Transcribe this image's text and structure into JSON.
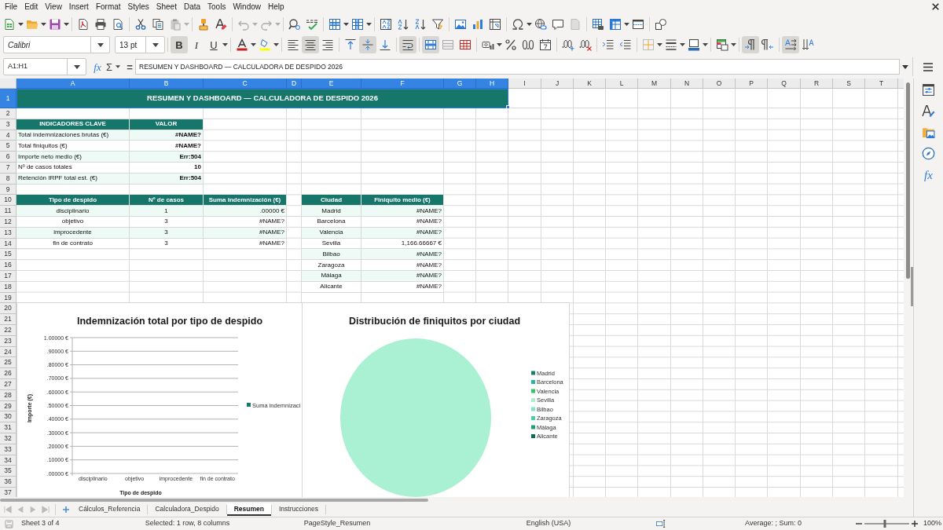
{
  "menu_bar": [
    "File",
    "Edit",
    "View",
    "Insert",
    "Format",
    "Styles",
    "Sheet",
    "Data",
    "Tools",
    "Window",
    "Help"
  ],
  "format_toolbar": {
    "font_name": "Calibri",
    "font_size": "13 pt",
    "bold": {
      "label": "B",
      "on": true
    },
    "italic": {
      "label": "I",
      "on": false
    },
    "underline": {
      "label": "U",
      "on": false
    },
    "align_left": false,
    "align_center": true,
    "align_right": false,
    "align_top": false,
    "align_middle": true,
    "align_bottom": false,
    "wrap_text": true,
    "merge_and_center": true,
    "merge_cells": false,
    "unmerge_cells": false,
    "left_to_right": true,
    "right_to_left": false,
    "text_horizontal": true,
    "text_vertical": false
  },
  "formula_bar": {
    "name_box": "A1:H1",
    "function_wizard": "fx",
    "sum": "Σ",
    "formula_sign": "=",
    "content": "RESUMEN Y DASHBOARD — CALCULADORA DE DESPIDO 2026"
  },
  "sidebar": {
    "functions": "fx"
  },
  "column_headers": [
    {
      "label": "A",
      "selected": true
    },
    {
      "label": "B",
      "selected": true
    },
    {
      "label": "C",
      "selected": true
    },
    {
      "label": "D",
      "selected": true
    },
    {
      "label": "E",
      "selected": true
    },
    {
      "label": "F",
      "selected": true
    },
    {
      "label": "G",
      "selected": true
    },
    {
      "label": "H",
      "selected": true
    },
    {
      "label": "I",
      "selected": false
    },
    {
      "label": "J",
      "selected": false
    },
    {
      "label": "K",
      "selected": false
    },
    {
      "label": "L",
      "selected": false
    },
    {
      "label": "M",
      "selected": false
    },
    {
      "label": "N",
      "selected": false
    },
    {
      "label": "O",
      "selected": false
    },
    {
      "label": "P",
      "selected": false
    },
    {
      "label": "Q",
      "selected": false
    },
    {
      "label": "R",
      "selected": false
    },
    {
      "label": "S",
      "selected": false
    },
    {
      "label": "T",
      "selected": false
    }
  ],
  "row_headers": [
    {
      "label": "1",
      "selected": true
    },
    {
      "label": "2",
      "selected": false
    },
    {
      "label": "3",
      "selected": false
    },
    {
      "label": "4",
      "selected": false
    },
    {
      "label": "5",
      "selected": false
    },
    {
      "label": "6",
      "selected": false
    },
    {
      "label": "7",
      "selected": false
    },
    {
      "label": "8",
      "selected": false
    },
    {
      "label": "9",
      "selected": false
    },
    {
      "label": "10",
      "selected": false
    },
    {
      "label": "11",
      "selected": false
    },
    {
      "label": "12",
      "selected": false
    },
    {
      "label": "13",
      "selected": false
    },
    {
      "label": "14",
      "selected": false
    },
    {
      "label": "15",
      "selected": false
    },
    {
      "label": "16",
      "selected": false
    },
    {
      "label": "17",
      "selected": false
    },
    {
      "label": "18",
      "selected": false
    },
    {
      "label": "19",
      "selected": false
    },
    {
      "label": "20",
      "selected": false
    },
    {
      "label": "21",
      "selected": false
    },
    {
      "label": "22",
      "selected": false
    },
    {
      "label": "23",
      "selected": false
    },
    {
      "label": "24",
      "selected": false
    },
    {
      "label": "25",
      "selected": false
    },
    {
      "label": "26",
      "selected": false
    },
    {
      "label": "27",
      "selected": false
    },
    {
      "label": "28",
      "selected": false
    },
    {
      "label": "29",
      "selected": false
    },
    {
      "label": "30",
      "selected": false
    },
    {
      "label": "31",
      "selected": false
    },
    {
      "label": "32",
      "selected": false
    },
    {
      "label": "33",
      "selected": false
    },
    {
      "label": "34",
      "selected": false
    },
    {
      "label": "35",
      "selected": false
    },
    {
      "label": "36",
      "selected": false
    },
    {
      "label": "37",
      "selected": false
    }
  ],
  "sheet": {
    "title": "RESUMEN Y DASHBOARD — CALCULADORA DE DESPIDO 2026",
    "kpi_table": {
      "columns": [
        "INDICADORES CLAVE",
        "VALOR"
      ],
      "rows": [
        {
          "label": "Total indemnizaciones brutas (€)",
          "value": "#NAME?"
        },
        {
          "label": "Total finiquitos (€)",
          "value": "#NAME?"
        },
        {
          "label": "Importe neto medio (€)",
          "value": "Err:504"
        },
        {
          "label": "Nº de casos totales",
          "value": "10"
        },
        {
          "label": "Retención IRPF total est. (€)",
          "value": "Err:504"
        }
      ]
    },
    "dismissal_table": {
      "columns": [
        "Tipo de despido",
        "Nº de casos",
        "Suma indemnización (€)"
      ],
      "rows": [
        [
          "disciplinario",
          "1",
          ".00000 €"
        ],
        [
          "objetivo",
          "3",
          "#NAME?"
        ],
        [
          "improcedente",
          "3",
          "#NAME?"
        ],
        [
          "fin de contrato",
          "3",
          "#NAME?"
        ]
      ]
    },
    "city_table": {
      "columns": [
        "Ciudad",
        "Finiquito medio (€)"
      ],
      "rows": [
        [
          "Madrid",
          "#NAME?"
        ],
        [
          "Barcelona",
          "#NAME?"
        ],
        [
          "Valencia",
          "#NAME?"
        ],
        [
          "Sevilla",
          "1,166.66667 €"
        ],
        [
          "Bilbao",
          "#NAME?"
        ],
        [
          "Zaragoza",
          "#NAME?"
        ],
        [
          "Málaga",
          "#NAME?"
        ],
        [
          "Alicante",
          "#NAME?"
        ]
      ]
    }
  },
  "charts": [
    {
      "chart_data": {
        "type": "bar",
        "title": "Indemnización total por tipo de despido",
        "xlabel": "Tipo de despido",
        "ylabel": "Importe (€)",
        "categories": [
          "disciplinario",
          "objetivo",
          "improcedente",
          "fin de contrato"
        ],
        "series": [
          {
            "name": "Suma indemnizaci",
            "color": "#1a7a6e",
            "values": [
              0,
              null,
              null,
              null
            ]
          }
        ],
        "ylim": [
          0,
          1
        ],
        "yticks": [
          {
            "value": 0,
            "label": ".00000 €"
          },
          {
            "value": 0.1,
            "label": ".10000 €"
          },
          {
            "value": 0.2,
            "label": ".20000 €"
          },
          {
            "value": 0.3,
            "label": ".30000 €"
          },
          {
            "value": 0.4,
            "label": ".40000 €"
          },
          {
            "value": 0.5,
            "label": ".50000 €"
          },
          {
            "value": 0.6,
            "label": ".60000 €"
          },
          {
            "value": 0.7,
            "label": ".70000 €"
          },
          {
            "value": 0.8,
            "label": ".80000 €"
          },
          {
            "value": 0.9,
            "label": ".90000 €"
          },
          {
            "value": 1,
            "label": "1.00000 €"
          }
        ],
        "grid": true
      }
    },
    {
      "chart_data": {
        "type": "pie",
        "title": "Distribución de finiquitos por ciudad",
        "categories": [
          "Madrid",
          "Barcelona",
          "Valencia",
          "Sevilla",
          "Bilbao",
          "Zaragoza",
          "Málaga",
          "Alicante"
        ],
        "values": [
          0,
          0,
          0,
          100,
          0,
          0,
          0,
          0
        ]
      },
      "legend_swatches": [
        {
          "color": "#1d7d72"
        },
        {
          "color": "#2bb3a3"
        },
        {
          "color": "#33c46f"
        },
        {
          "color": "#aaf0d2"
        },
        {
          "color": "#80e3c3"
        },
        {
          "color": "#3fd3a6"
        },
        {
          "color": "#21a06f"
        },
        {
          "color": "#116b52"
        }
      ]
    }
  ],
  "sheet_tabs": [
    {
      "label": "Cálculos_Referencia",
      "selected": false
    },
    {
      "label": "Calculadora_Despido",
      "selected": false
    },
    {
      "label": "Resumen",
      "selected": true
    },
    {
      "label": "Instrucciones",
      "selected": false
    }
  ],
  "status_bar": {
    "sheet_position": "Sheet 3 of 4",
    "selection": "Selected: 1 row, 8 columns",
    "page_style": "PageStyle_Resumen",
    "language": "English (USA)",
    "summary": "Average: ; Sum: 0",
    "zoom": {
      "level": 0.45,
      "reading": "100%"
    }
  }
}
